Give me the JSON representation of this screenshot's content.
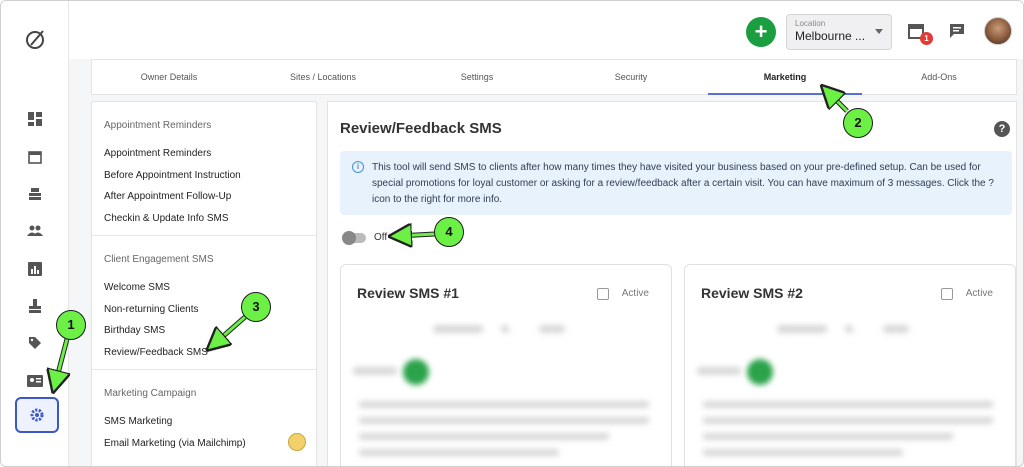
{
  "topbar": {
    "add_label": "+",
    "location_label": "Location",
    "location_value": "Melbourne ...",
    "notification_count": "1"
  },
  "tabs": [
    {
      "label": "Owner Details"
    },
    {
      "label": "Sites / Locations"
    },
    {
      "label": "Settings"
    },
    {
      "label": "Security"
    },
    {
      "label": "Marketing",
      "active": true
    },
    {
      "label": "Add-Ons"
    }
  ],
  "menu": {
    "sections": [
      {
        "title": "Appointment Reminders",
        "items": [
          "Appointment Reminders",
          "Before Appointment Instruction",
          "After Appointment Follow-Up",
          "Checkin & Update Info SMS"
        ]
      },
      {
        "title": "Client Engagement SMS",
        "items": [
          "Welcome SMS",
          "Non-returning Clients",
          "Birthday SMS",
          "Review/Feedback SMS"
        ]
      },
      {
        "title": "Marketing Campaign",
        "items": [
          "SMS Marketing",
          "Email Marketing (via Mailchimp)"
        ]
      }
    ]
  },
  "main": {
    "title": "Review/Feedback SMS",
    "help": "?",
    "info_text": "This tool will send SMS to clients after how many times they have visited your business based on your pre-defined setup. Can be used for special promotions for loyal customer or asking for a review/feedback after a certain visit. You can have maximum of 3 messages. Click the ? icon to the right for more info.",
    "toggle_label": "Off",
    "cards": [
      {
        "title": "Review SMS #1",
        "active_label": "Active"
      },
      {
        "title": "Review SMS #2",
        "active_label": "Active"
      }
    ]
  },
  "annotations": [
    "1",
    "2",
    "3",
    "4"
  ],
  "colors": {
    "brand_green": "#1a9e3f",
    "accent_blue": "#5a6fd6",
    "annotation_green": "#6cf046",
    "badge_red": "#e53935"
  }
}
